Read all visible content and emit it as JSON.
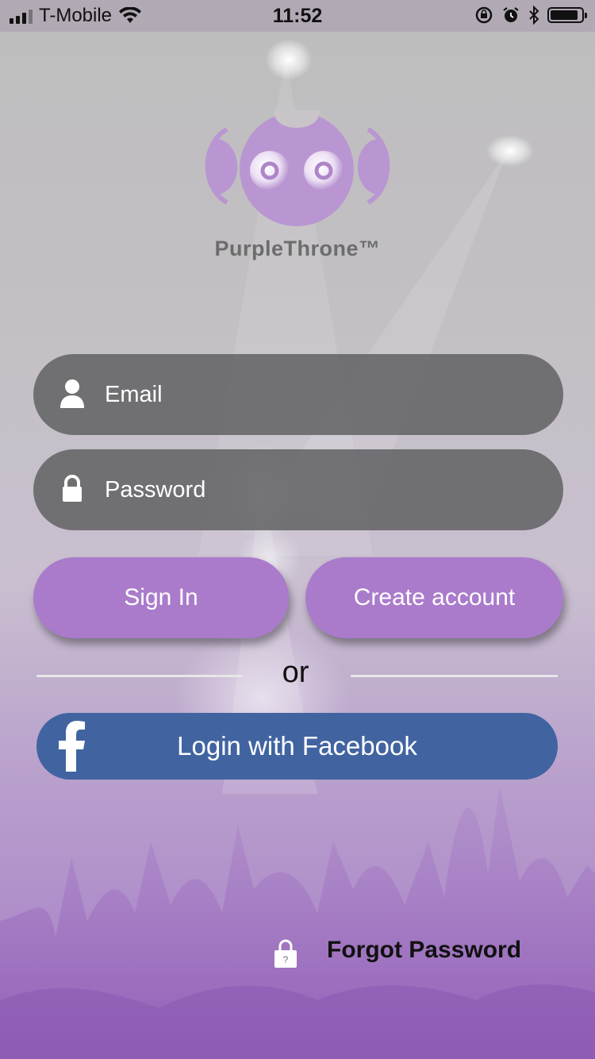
{
  "status_bar": {
    "carrier": "T-Mobile",
    "time": "11:52"
  },
  "brand": {
    "name": "PurpleThrone™",
    "logo_icon": "purple-robot-logo-icon"
  },
  "login_form": {
    "email_placeholder": "Email",
    "password_placeholder": "Password",
    "email_icon": "user-icon",
    "password_icon": "lock-icon",
    "sign_in_label": "Sign In",
    "create_account_label": "Create account",
    "or_text": "or",
    "facebook_label": "Login with Facebook",
    "forgot_label": "Forgot Password"
  },
  "colors": {
    "primary_purple": "#aa7bcb",
    "facebook_blue": "#4164a1",
    "field_gray": "#646466"
  }
}
